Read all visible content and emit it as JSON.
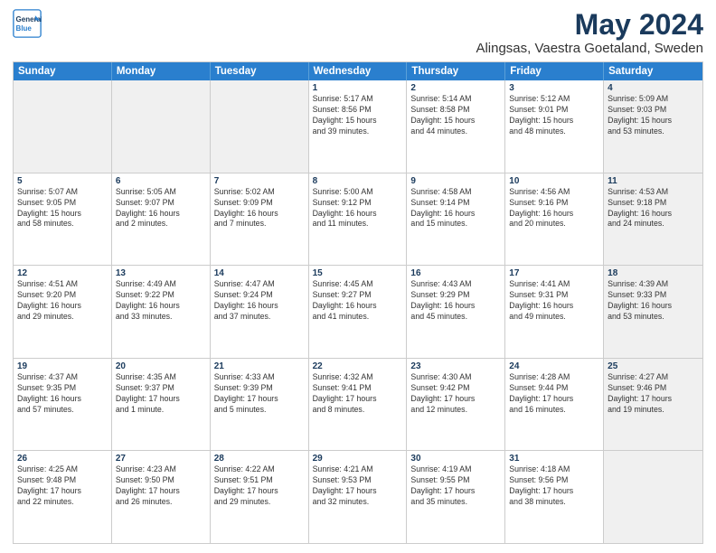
{
  "header": {
    "logo_line1": "General",
    "logo_line2": "Blue",
    "title": "May 2024",
    "subtitle": "Alingsas, Vaestra Goetaland, Sweden"
  },
  "weekdays": [
    "Sunday",
    "Monday",
    "Tuesday",
    "Wednesday",
    "Thursday",
    "Friday",
    "Saturday"
  ],
  "rows": [
    [
      {
        "day": "",
        "info": "",
        "shaded": true
      },
      {
        "day": "",
        "info": "",
        "shaded": true
      },
      {
        "day": "",
        "info": "",
        "shaded": true
      },
      {
        "day": "1",
        "info": "Sunrise: 5:17 AM\nSunset: 8:56 PM\nDaylight: 15 hours\nand 39 minutes."
      },
      {
        "day": "2",
        "info": "Sunrise: 5:14 AM\nSunset: 8:58 PM\nDaylight: 15 hours\nand 44 minutes."
      },
      {
        "day": "3",
        "info": "Sunrise: 5:12 AM\nSunset: 9:01 PM\nDaylight: 15 hours\nand 48 minutes."
      },
      {
        "day": "4",
        "info": "Sunrise: 5:09 AM\nSunset: 9:03 PM\nDaylight: 15 hours\nand 53 minutes.",
        "shaded": true
      }
    ],
    [
      {
        "day": "5",
        "info": "Sunrise: 5:07 AM\nSunset: 9:05 PM\nDaylight: 15 hours\nand 58 minutes."
      },
      {
        "day": "6",
        "info": "Sunrise: 5:05 AM\nSunset: 9:07 PM\nDaylight: 16 hours\nand 2 minutes."
      },
      {
        "day": "7",
        "info": "Sunrise: 5:02 AM\nSunset: 9:09 PM\nDaylight: 16 hours\nand 7 minutes."
      },
      {
        "day": "8",
        "info": "Sunrise: 5:00 AM\nSunset: 9:12 PM\nDaylight: 16 hours\nand 11 minutes."
      },
      {
        "day": "9",
        "info": "Sunrise: 4:58 AM\nSunset: 9:14 PM\nDaylight: 16 hours\nand 15 minutes."
      },
      {
        "day": "10",
        "info": "Sunrise: 4:56 AM\nSunset: 9:16 PM\nDaylight: 16 hours\nand 20 minutes."
      },
      {
        "day": "11",
        "info": "Sunrise: 4:53 AM\nSunset: 9:18 PM\nDaylight: 16 hours\nand 24 minutes.",
        "shaded": true
      }
    ],
    [
      {
        "day": "12",
        "info": "Sunrise: 4:51 AM\nSunset: 9:20 PM\nDaylight: 16 hours\nand 29 minutes."
      },
      {
        "day": "13",
        "info": "Sunrise: 4:49 AM\nSunset: 9:22 PM\nDaylight: 16 hours\nand 33 minutes."
      },
      {
        "day": "14",
        "info": "Sunrise: 4:47 AM\nSunset: 9:24 PM\nDaylight: 16 hours\nand 37 minutes."
      },
      {
        "day": "15",
        "info": "Sunrise: 4:45 AM\nSunset: 9:27 PM\nDaylight: 16 hours\nand 41 minutes."
      },
      {
        "day": "16",
        "info": "Sunrise: 4:43 AM\nSunset: 9:29 PM\nDaylight: 16 hours\nand 45 minutes."
      },
      {
        "day": "17",
        "info": "Sunrise: 4:41 AM\nSunset: 9:31 PM\nDaylight: 16 hours\nand 49 minutes."
      },
      {
        "day": "18",
        "info": "Sunrise: 4:39 AM\nSunset: 9:33 PM\nDaylight: 16 hours\nand 53 minutes.",
        "shaded": true
      }
    ],
    [
      {
        "day": "19",
        "info": "Sunrise: 4:37 AM\nSunset: 9:35 PM\nDaylight: 16 hours\nand 57 minutes."
      },
      {
        "day": "20",
        "info": "Sunrise: 4:35 AM\nSunset: 9:37 PM\nDaylight: 17 hours\nand 1 minute."
      },
      {
        "day": "21",
        "info": "Sunrise: 4:33 AM\nSunset: 9:39 PM\nDaylight: 17 hours\nand 5 minutes."
      },
      {
        "day": "22",
        "info": "Sunrise: 4:32 AM\nSunset: 9:41 PM\nDaylight: 17 hours\nand 8 minutes."
      },
      {
        "day": "23",
        "info": "Sunrise: 4:30 AM\nSunset: 9:42 PM\nDaylight: 17 hours\nand 12 minutes."
      },
      {
        "day": "24",
        "info": "Sunrise: 4:28 AM\nSunset: 9:44 PM\nDaylight: 17 hours\nand 16 minutes."
      },
      {
        "day": "25",
        "info": "Sunrise: 4:27 AM\nSunset: 9:46 PM\nDaylight: 17 hours\nand 19 minutes.",
        "shaded": true
      }
    ],
    [
      {
        "day": "26",
        "info": "Sunrise: 4:25 AM\nSunset: 9:48 PM\nDaylight: 17 hours\nand 22 minutes."
      },
      {
        "day": "27",
        "info": "Sunrise: 4:23 AM\nSunset: 9:50 PM\nDaylight: 17 hours\nand 26 minutes."
      },
      {
        "day": "28",
        "info": "Sunrise: 4:22 AM\nSunset: 9:51 PM\nDaylight: 17 hours\nand 29 minutes."
      },
      {
        "day": "29",
        "info": "Sunrise: 4:21 AM\nSunset: 9:53 PM\nDaylight: 17 hours\nand 32 minutes."
      },
      {
        "day": "30",
        "info": "Sunrise: 4:19 AM\nSunset: 9:55 PM\nDaylight: 17 hours\nand 35 minutes."
      },
      {
        "day": "31",
        "info": "Sunrise: 4:18 AM\nSunset: 9:56 PM\nDaylight: 17 hours\nand 38 minutes."
      },
      {
        "day": "",
        "info": "",
        "shaded": true
      }
    ]
  ]
}
